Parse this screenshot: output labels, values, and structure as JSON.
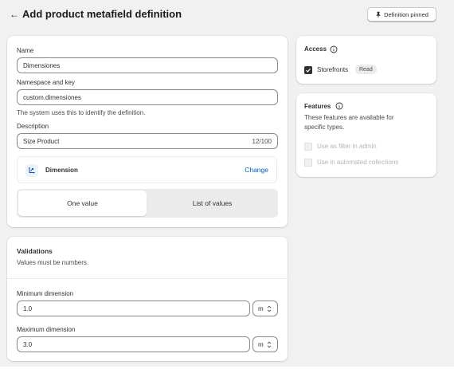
{
  "header": {
    "title": "Add product metafield definition",
    "pin_label": "Definition pinned"
  },
  "definition": {
    "name_label": "Name",
    "name_value": "Dimensiones",
    "key_label": "Namespace and key",
    "key_value": "custom.dimensiones",
    "key_help": "The system uses this to identify the definition.",
    "description_label": "Description",
    "description_value": "Size Product",
    "description_count": "12/100",
    "type_label": "Dimension",
    "change_label": "Change",
    "one_value_label": "One value",
    "list_values_label": "List of values",
    "selected_option": "One value"
  },
  "validations": {
    "title": "Validations",
    "subtitle": "Values must be numbers.",
    "min_label": "Minimum dimension",
    "min_value": "1.0",
    "min_unit": "m",
    "max_label": "Maximum dimension",
    "max_value": "3.0",
    "max_unit": "m"
  },
  "access": {
    "title": "Access",
    "storefronts_label": "Storefronts",
    "storefronts_checked": true,
    "storefronts_badge": "Read"
  },
  "features": {
    "title": "Features",
    "description": "These features are available for specific types.",
    "filter_label": "Use as filter in admin",
    "automated_label": "Use in automated collections"
  },
  "colors": {
    "link": "#005bd3",
    "page_bg": "#f1f1f1",
    "card_bg": "#ffffff"
  },
  "icons": [
    "back-arrow",
    "pin-icon",
    "dimension-icon",
    "chevron-updown-icon",
    "info-icon",
    "check-icon"
  ]
}
